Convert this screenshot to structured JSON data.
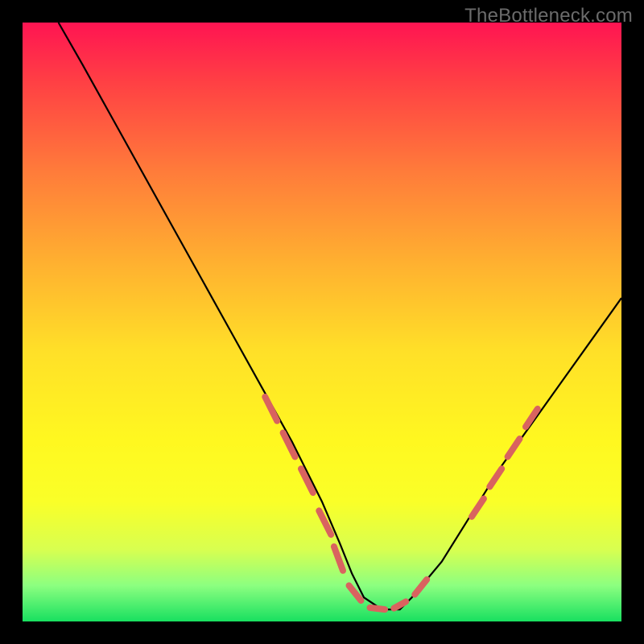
{
  "watermark": "TheBottleneck.com",
  "chart_data": {
    "type": "line",
    "title": "",
    "xlabel": "",
    "ylabel": "",
    "xlim": [
      0,
      100
    ],
    "ylim": [
      0,
      100
    ],
    "grid": false,
    "legend": false,
    "series": [
      {
        "name": "curve",
        "stroke": "#000000",
        "x": [
          6,
          10,
          15,
          20,
          25,
          30,
          35,
          40,
          45,
          50,
          53,
          55,
          57,
          60,
          63,
          65,
          70,
          75,
          80,
          85,
          90,
          95,
          100
        ],
        "values": [
          100,
          93,
          84,
          75,
          66,
          57,
          48,
          39,
          30,
          20,
          13,
          8,
          4,
          2,
          2,
          4,
          10,
          18,
          26,
          33,
          40,
          47,
          54
        ]
      }
    ],
    "highlight_dashes": {
      "stroke": "#d9635f",
      "stroke_width": 8,
      "segments": [
        {
          "x1": 40.5,
          "y1": 37.5,
          "x2": 42.5,
          "y2": 33.5
        },
        {
          "x1": 43.5,
          "y1": 31.5,
          "x2": 45.5,
          "y2": 27.5
        },
        {
          "x1": 46.5,
          "y1": 25.5,
          "x2": 48.5,
          "y2": 21.5
        },
        {
          "x1": 49.5,
          "y1": 18.5,
          "x2": 51.5,
          "y2": 14.5
        },
        {
          "x1": 52.0,
          "y1": 12.5,
          "x2": 53.5,
          "y2": 8.5
        },
        {
          "x1": 54.5,
          "y1": 6.0,
          "x2": 56.5,
          "y2": 3.5
        },
        {
          "x1": 58.0,
          "y1": 2.3,
          "x2": 60.5,
          "y2": 2.0
        },
        {
          "x1": 62.0,
          "y1": 2.2,
          "x2": 64.0,
          "y2": 3.3
        },
        {
          "x1": 65.5,
          "y1": 4.5,
          "x2": 67.5,
          "y2": 7.0
        },
        {
          "x1": 75.0,
          "y1": 17.5,
          "x2": 77.0,
          "y2": 20.5
        },
        {
          "x1": 78.0,
          "y1": 22.5,
          "x2": 80.0,
          "y2": 25.5
        },
        {
          "x1": 81.0,
          "y1": 27.5,
          "x2": 83.0,
          "y2": 30.5
        },
        {
          "x1": 84.0,
          "y1": 32.5,
          "x2": 86.0,
          "y2": 35.5
        }
      ]
    }
  }
}
